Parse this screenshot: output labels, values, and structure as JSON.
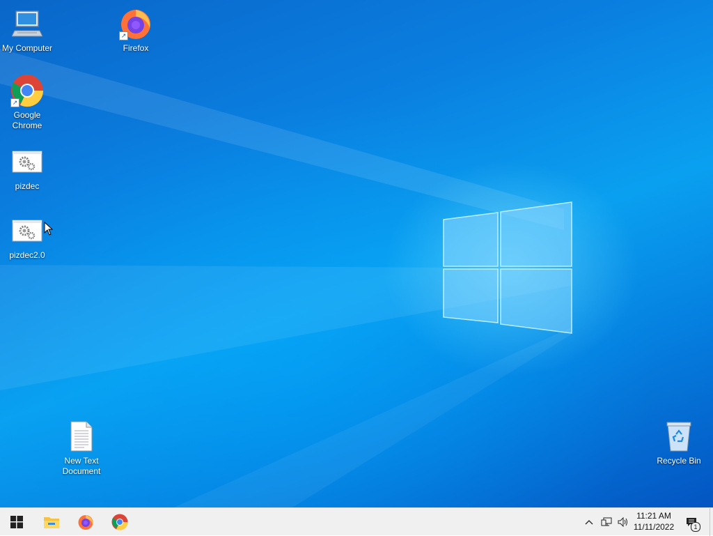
{
  "desktop": {
    "icons": [
      {
        "label": "My Computer",
        "icon": "computer-icon"
      },
      {
        "label": "Firefox",
        "icon": "firefox-icon",
        "shortcut": true
      },
      {
        "label": "Google\nChrome",
        "icon": "chrome-icon",
        "shortcut": true
      },
      {
        "label": "pizdec",
        "icon": "settings-app-icon"
      },
      {
        "label": "pizdec2.0",
        "icon": "settings-app-icon"
      },
      {
        "label": "New Text\nDocument",
        "icon": "text-document-icon"
      },
      {
        "label": "Recycle Bin",
        "icon": "recycle-bin-icon"
      }
    ],
    "wallpaper_colors": {
      "deep": "#0455c2",
      "mid": "#0a7fe0",
      "light": "#0aa0f0",
      "glow": "#78e1ff"
    }
  },
  "taskbar": {
    "pinned": [
      {
        "icon": "start-windows-icon"
      },
      {
        "icon": "file-explorer-icon"
      },
      {
        "icon": "firefox-icon"
      },
      {
        "icon": "chrome-icon"
      }
    ],
    "tray_icons": [
      "chevron-up-icon",
      "network-icon",
      "volume-icon"
    ],
    "clock": {
      "time": "11:21 AM",
      "date": "11/11/2022"
    },
    "notifications": {
      "icon": "action-center-icon",
      "count": "1"
    }
  }
}
